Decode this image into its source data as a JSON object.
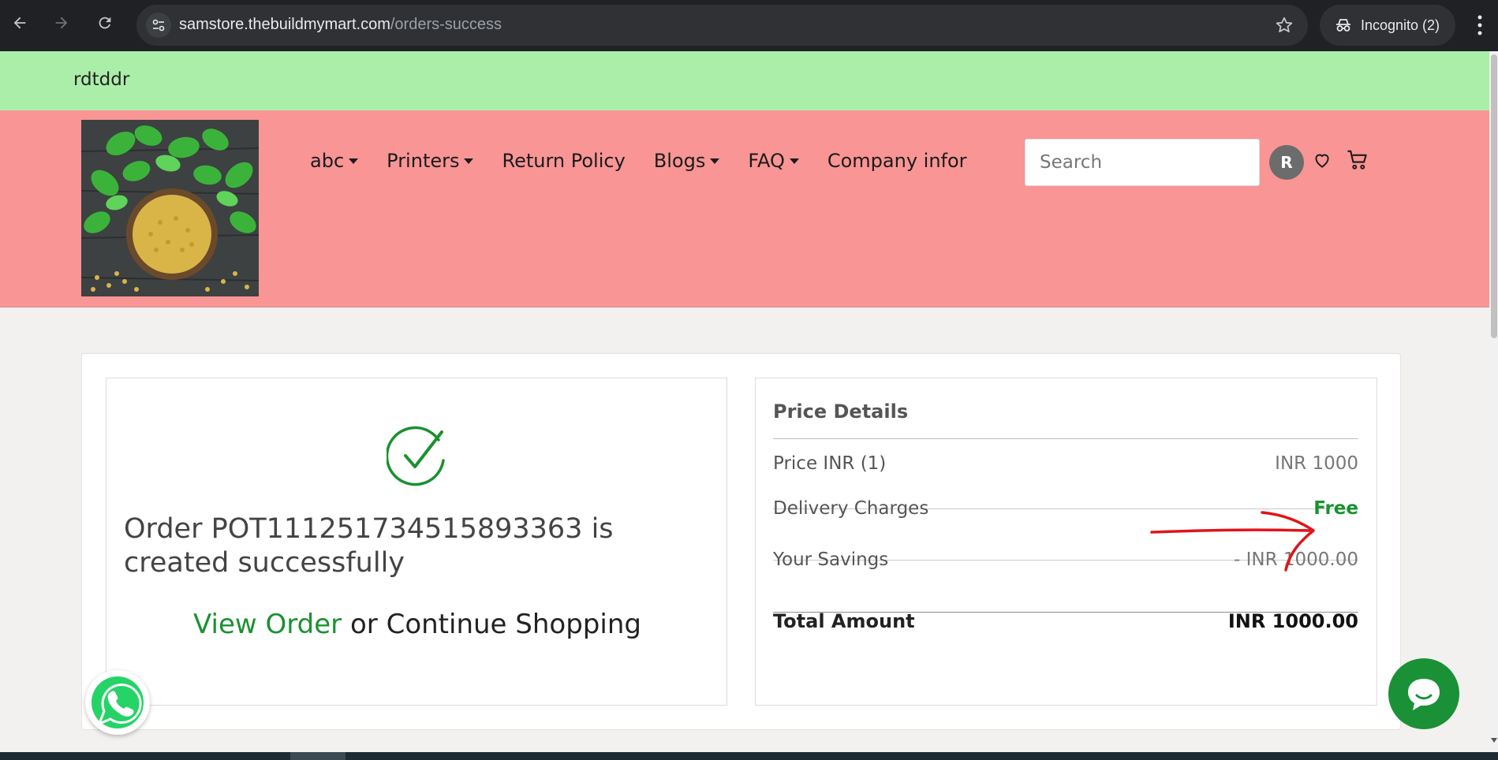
{
  "browser": {
    "url_host": "samstore.thebuildmymart.com",
    "url_path": "/orders-success",
    "incognito_label": "Incognito (2)"
  },
  "announcement": "rdtddr",
  "header": {
    "menu": [
      {
        "label": "abc",
        "dropdown": true
      },
      {
        "label": "Printers",
        "dropdown": true
      },
      {
        "label": "Return Policy",
        "dropdown": false
      },
      {
        "label": "Blogs",
        "dropdown": true
      },
      {
        "label": "FAQ",
        "dropdown": true
      },
      {
        "label": "Company infor",
        "dropdown": false
      }
    ],
    "search_placeholder": "Search",
    "avatar_initial": "R"
  },
  "order": {
    "message": "Order POT111251734515893363 is created successfully",
    "view_order_label": "View Order",
    "or_label": "or",
    "continue_label": "Continue Shopping"
  },
  "price_details": {
    "title": "Price Details",
    "rows": [
      {
        "label": "Price INR (1)",
        "value": "INR 1000"
      },
      {
        "label": "Delivery Charges",
        "value": "Free"
      },
      {
        "label": "Your Savings",
        "value": "- INR 1000.00"
      }
    ],
    "total_label": "Total Amount",
    "total_value": "INR 1000.00"
  },
  "colors": {
    "announcement_bg": "#abeea9",
    "header_bg": "#f99595",
    "accent_green": "#1a9130",
    "annotation_red": "#e0141a"
  }
}
